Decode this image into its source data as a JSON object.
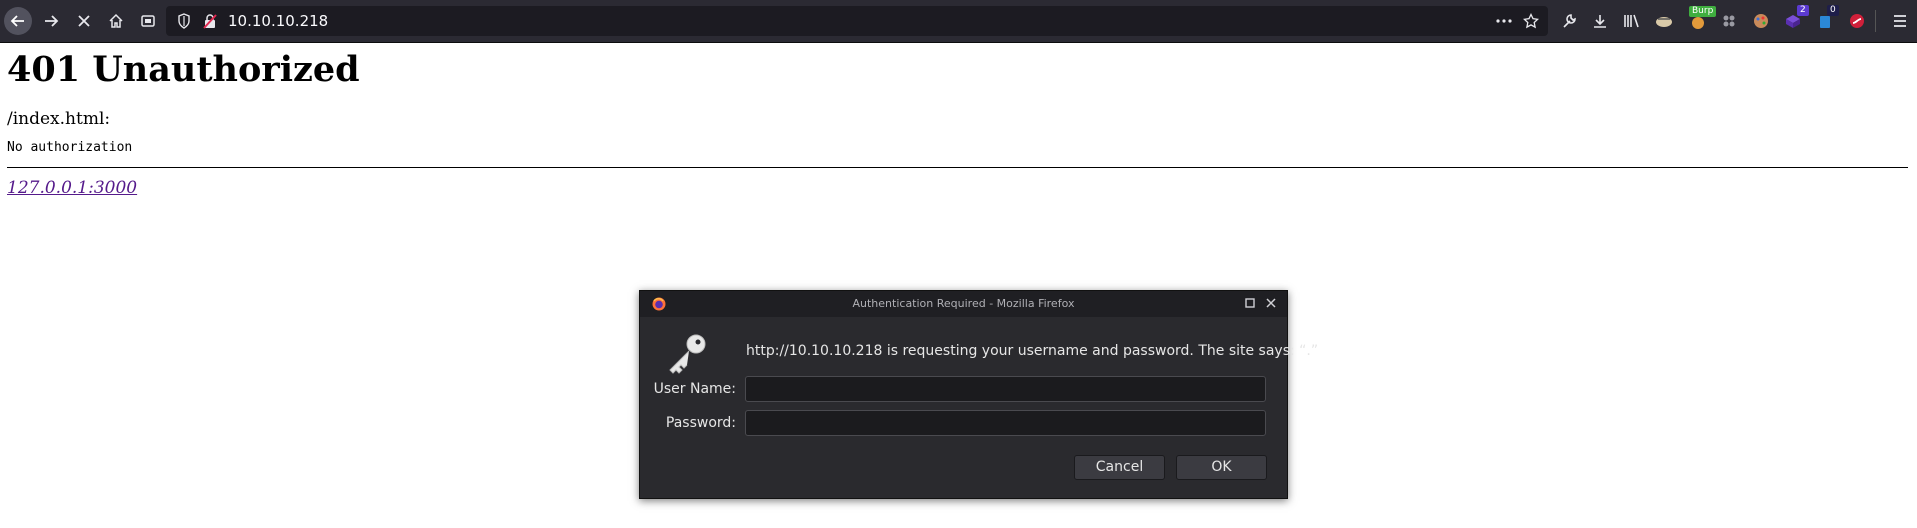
{
  "browser": {
    "url": "10.10.10.218",
    "extensions": {
      "burp_badge": "Burp",
      "badge_a": "2",
      "badge_b": "0"
    }
  },
  "page": {
    "title": "401 Unauthorized",
    "path": "/index.html:",
    "message": "No authorization",
    "link_text": "127.0.0.1:3000"
  },
  "dialog": {
    "title": "Authentication Required - Mozilla Firefox",
    "message": "http://10.10.10.218 is requesting your username and password. The site says: “.”",
    "username_label": "User Name:",
    "password_label": "Password:",
    "username_value": "",
    "password_value": "",
    "cancel_label": "Cancel",
    "ok_label": "OK"
  }
}
